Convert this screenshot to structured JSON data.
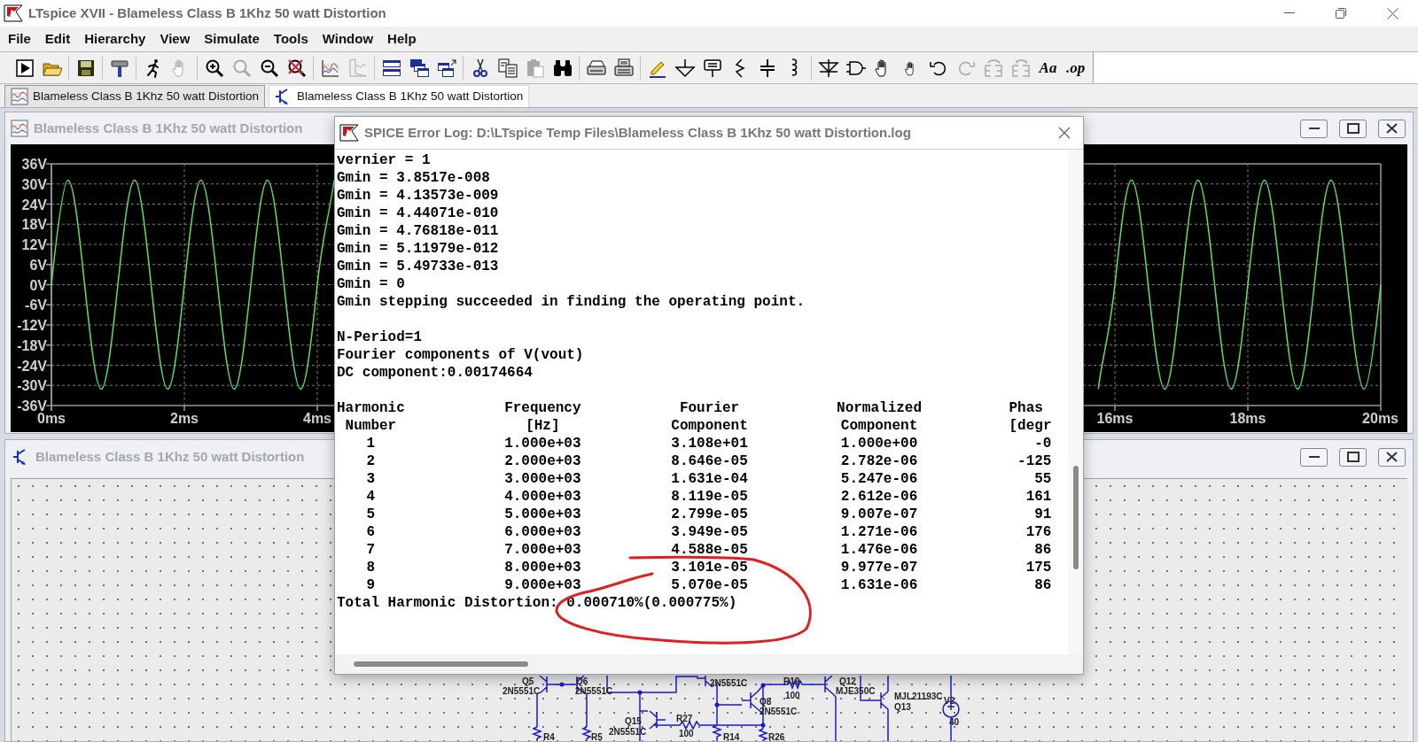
{
  "window": {
    "title": "LTspice XVII - Blameless Class B 1Khz 50 watt Distortion"
  },
  "menu": [
    "File",
    "Edit",
    "Hierarchy",
    "View",
    "Simulate",
    "Tools",
    "Window",
    "Help"
  ],
  "toolbar": [
    {
      "kind": "run",
      "disabled": false
    },
    {
      "kind": "open",
      "disabled": false
    },
    {
      "kind": "save",
      "disabled": false
    },
    {
      "kind": "hammer",
      "disabled": false
    },
    {
      "kind": "runner",
      "disabled": false
    },
    {
      "kind": "hand",
      "disabled": true
    },
    {
      "kind": "zoomin",
      "disabled": false
    },
    {
      "kind": "zoom",
      "disabled": true
    },
    {
      "kind": "zoomout",
      "disabled": false
    },
    {
      "kind": "zoomcancel",
      "disabled": false
    },
    {
      "kind": "plot",
      "disabled": false
    },
    {
      "kind": "plotframe",
      "disabled": true
    },
    {
      "kind": "tile",
      "disabled": false
    },
    {
      "kind": "cascade",
      "disabled": false
    },
    {
      "kind": "tilearrow",
      "disabled": false
    },
    {
      "kind": "cut",
      "disabled": false
    },
    {
      "kind": "copy",
      "disabled": false
    },
    {
      "kind": "paste",
      "disabled": true
    },
    {
      "kind": "find",
      "disabled": false
    },
    {
      "kind": "print",
      "disabled": false
    },
    {
      "kind": "printer",
      "disabled": false
    },
    {
      "kind": "pencil",
      "disabled": false
    },
    {
      "kind": "ground",
      "disabled": false
    },
    {
      "kind": "label",
      "disabled": false
    },
    {
      "kind": "resistor",
      "disabled": false
    },
    {
      "kind": "capacitor",
      "disabled": false
    },
    {
      "kind": "inductor",
      "disabled": false
    },
    {
      "kind": "diode",
      "disabled": false
    },
    {
      "kind": "gate",
      "disabled": false
    },
    {
      "kind": "drag",
      "disabled": false
    },
    {
      "kind": "move",
      "disabled": false
    },
    {
      "kind": "undo",
      "disabled": false
    },
    {
      "kind": "redo",
      "disabled": true
    },
    {
      "kind": "mirror",
      "disabled": true
    },
    {
      "kind": "mirror",
      "disabled": true
    },
    {
      "kind": "text",
      "label": "Aa",
      "disabled": false
    },
    {
      "kind": "text",
      "label": ".op",
      "disabled": false
    }
  ],
  "tabs": [
    {
      "kind": "waveform",
      "label": "Blameless Class B 1Khz 50 watt Distortion",
      "selected": false
    },
    {
      "kind": "schematic",
      "label": "Blameless Class B 1Khz 50 watt Distortion",
      "selected": true
    }
  ],
  "waveform_window": {
    "title": "Blameless Class B 1Khz 50 watt Distortion",
    "chart_data": {
      "type": "line",
      "xlim": [
        0,
        20
      ],
      "ylim": [
        -36,
        36
      ],
      "xticks": [
        {
          "value": 0,
          "label": "0ms"
        },
        {
          "value": 2,
          "label": "2ms"
        },
        {
          "value": 4,
          "label": "4ms"
        },
        {
          "value": 16,
          "label": "16ms"
        },
        {
          "value": 18,
          "label": "18ms"
        },
        {
          "value": 20,
          "label": "20ms"
        }
      ],
      "yticks": [
        {
          "value": 36,
          "label": "36V"
        },
        {
          "value": 30,
          "label": "30V"
        },
        {
          "value": 24,
          "label": "24V"
        },
        {
          "value": 18,
          "label": "18V"
        },
        {
          "value": 12,
          "label": "12V"
        },
        {
          "value": 6,
          "label": "6V"
        },
        {
          "value": 0,
          "label": "0V"
        },
        {
          "value": -6,
          "label": "-6V"
        },
        {
          "value": -12,
          "label": "-12V"
        },
        {
          "value": -18,
          "label": "-18V"
        },
        {
          "value": -24,
          "label": "-24V"
        },
        {
          "value": -30,
          "label": "-30V"
        },
        {
          "value": -36,
          "label": "-36V"
        }
      ],
      "x": [
        0,
        0.25,
        0.5,
        0.75,
        1,
        1.25,
        1.5,
        1.75,
        2,
        2.25,
        2.5,
        2.75,
        3,
        3.25,
        3.5,
        3.75,
        4,
        4.25,
        4.5,
        4.75,
        5,
        5.25,
        5.5,
        5.75,
        6,
        6.25,
        6.5,
        6.75,
        7,
        7.25,
        7.5,
        7.75,
        8,
        8.25,
        8.5,
        8.75,
        9,
        9.25,
        9.5,
        9.75,
        10,
        10.25,
        10.5,
        10.75,
        11,
        11.25,
        11.5,
        11.75,
        12,
        12.25,
        12.5,
        12.75,
        13,
        13.25,
        13.5,
        13.75,
        14,
        14.25,
        14.5,
        14.75,
        15,
        15.25,
        15.5,
        15.75,
        16,
        16.25,
        16.5,
        16.75,
        17,
        17.25,
        17.5,
        17.75,
        18,
        18.25,
        18.5,
        18.75,
        19,
        19.25,
        19.5,
        19.75,
        20
      ],
      "grid": true,
      "series": [
        {
          "color": "#5fe05f",
          "values": [
            0,
            31.1,
            0,
            -31.1,
            0,
            31.1,
            0,
            -31.1,
            0,
            31.1,
            0,
            -31.1,
            0,
            31.1,
            0,
            -31.1,
            0,
            31.1,
            null,
            null,
            null,
            null,
            null,
            null,
            null,
            null,
            null,
            null,
            null,
            null,
            null,
            null,
            null,
            null,
            null,
            null,
            null,
            null,
            null,
            null,
            null,
            null,
            null,
            null,
            null,
            null,
            null,
            null,
            null,
            null,
            null,
            null,
            null,
            null,
            null,
            null,
            null,
            null,
            null,
            null,
            null,
            null,
            null,
            -31.1,
            0,
            31.1,
            0,
            -31.1,
            0,
            31.1,
            0,
            -31.1,
            0,
            31.1,
            0,
            -31.1,
            0,
            31.1,
            0,
            -31.1,
            0
          ]
        }
      ]
    }
  },
  "schematic_window": {
    "title": "Blameless Class B 1Khz 50 watt Distortion",
    "labels": [
      "Q5",
      "Q6",
      "2N5551C",
      "R19",
      "Q12",
      "2N5551C",
      "2N5551C",
      "100",
      "MJE350C",
      "MJL21193C",
      "Q8",
      "2N5551C",
      "Q13",
      "V2",
      "Q15",
      "R27",
      "40",
      "2N5551C",
      "100",
      "R4",
      "R5",
      "R14",
      "R26"
    ]
  },
  "error_log": {
    "title": "SPICE Error Log: D:\\LTspice Temp Files\\Blameless Class B 1Khz 50 watt Distortion.log",
    "preamble": [
      "vernier = 1",
      "Gmin = 3.8517e-008",
      "Gmin = 4.13573e-009",
      "Gmin = 4.44071e-010",
      "Gmin = 4.76818e-011",
      "Gmin = 5.11979e-012",
      "Gmin = 5.49733e-013",
      "Gmin = 0",
      "Gmin stepping succeeded in finding the operating point."
    ],
    "fourier": [
      "N-Period=1",
      "Fourier components of V(vout)",
      "DC component:0.00174664"
    ],
    "table": {
      "columns": [
        {
          "header": [
            "Harmonic",
            "Number"
          ]
        },
        {
          "header": [
            "Frequency",
            "[Hz]"
          ]
        },
        {
          "header": [
            "Fourier",
            "Component"
          ]
        },
        {
          "header": [
            "Normalized",
            "Component"
          ]
        },
        {
          "header": [
            "Phas",
            "[degr"
          ]
        }
      ],
      "rows": [
        {
          "cells": [
            "1",
            "1.000e+03",
            "3.108e+01",
            "1.000e+00",
            "-0"
          ]
        },
        {
          "cells": [
            "2",
            "2.000e+03",
            "8.646e-05",
            "2.782e-06",
            "-125"
          ]
        },
        {
          "cells": [
            "3",
            "3.000e+03",
            "1.631e-04",
            "5.247e-06",
            "55"
          ]
        },
        {
          "cells": [
            "4",
            "4.000e+03",
            "8.119e-05",
            "2.612e-06",
            "161"
          ]
        },
        {
          "cells": [
            "5",
            "5.000e+03",
            "2.799e-05",
            "9.007e-07",
            "91"
          ]
        },
        {
          "cells": [
            "6",
            "6.000e+03",
            "3.949e-05",
            "1.271e-06",
            "176"
          ]
        },
        {
          "cells": [
            "7",
            "7.000e+03",
            "4.588e-05",
            "1.476e-06",
            "86"
          ]
        },
        {
          "cells": [
            "8",
            "8.000e+03",
            "3.101e-05",
            "9.977e-07",
            "175"
          ]
        },
        {
          "cells": [
            "9",
            "9.000e+03",
            "5.070e-05",
            "1.631e-06",
            "86"
          ]
        }
      ]
    },
    "summary": "Total Harmonic Distortion: 0.000710%(0.000775%)"
  }
}
